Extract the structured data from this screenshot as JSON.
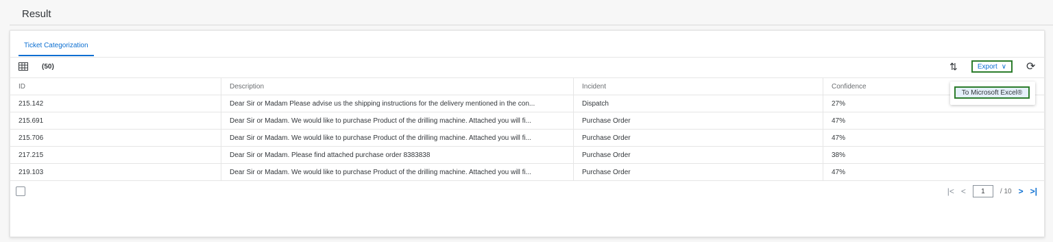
{
  "header": {
    "title": "Result"
  },
  "tabs": [
    {
      "label": "Ticket Categorization"
    }
  ],
  "toolbar": {
    "count": "(50)",
    "export_label": "Export"
  },
  "table": {
    "columns": [
      "ID",
      "Description",
      "Incident",
      "Confidence"
    ],
    "rows": [
      [
        "215.142",
        "Dear Sir or Madam Please advise us the shipping instructions for the delivery mentioned in the con...",
        "Dispatch",
        "27%"
      ],
      [
        "215.691",
        "Dear Sir or Madam. We would like to purchase Product of the drilling machine. Attached you will fi...",
        "Purchase Order",
        "47%"
      ],
      [
        "215.706",
        "Dear Sir or Madam. We would like to purchase Product of the drilling machine. Attached you will fi...",
        "Purchase Order",
        "47%"
      ],
      [
        "217.215",
        "Dear Sir or Madam. Please find attached purchase order 8383838",
        "Purchase Order",
        "38%"
      ],
      [
        "219.103",
        "Dear Sir or Madam. We would like to purchase Product of the drilling machine. Attached you will fi...",
        "Purchase Order",
        "47%"
      ]
    ]
  },
  "pagination": {
    "current_page": "1",
    "total": "/ 10"
  },
  "export_menu": {
    "items": [
      {
        "label": "To Microsoft Excel®"
      }
    ]
  },
  "icons": {
    "grid": "table-grid-icon",
    "sort": "sort-icon",
    "refresh": "refresh-icon",
    "first": "first-page-icon",
    "prev": "previous-page-icon",
    "next": "next-page-icon",
    "last": "last-page-icon"
  },
  "colors": {
    "accent": "#0a6ed1",
    "highlight_border": "#2b7c2b"
  }
}
